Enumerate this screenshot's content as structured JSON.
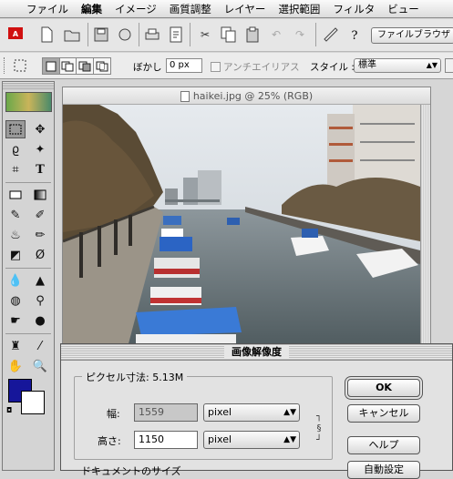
{
  "menubar": {
    "apple_icon": "apple-icon",
    "items": [
      "ファイル",
      "編集",
      "イメージ",
      "画質調整",
      "レイヤー",
      "選択範囲",
      "フィルタ",
      "ビュー"
    ],
    "active": "編集"
  },
  "toolbar": {
    "file_browser_label": "ファイルブラウザ"
  },
  "options": {
    "feather_label": "ぼかし :",
    "feather_value": "0 px",
    "antialias_label": "アンチエイリアス",
    "style_label": "スタイル :",
    "style_value": "標準"
  },
  "document": {
    "title": "haikei.jpg @ 25% (RGB)"
  },
  "colors": {
    "foreground": "#16169a",
    "background": "#ffffff"
  },
  "dialog": {
    "title": "画像解像度",
    "pixel_dimensions_label": "ピクセル寸法: 5.13M",
    "width_label": "幅:",
    "width_value": "1559",
    "width_unit": "pixel",
    "height_label": "高さ:",
    "height_value": "1150",
    "height_unit": "pixel",
    "ok_label": "OK",
    "cancel_label": "キャンセル",
    "help_label": "ヘルプ",
    "auto_label": "自動設定",
    "next_section_label": "ドキュメントのサイズ"
  }
}
